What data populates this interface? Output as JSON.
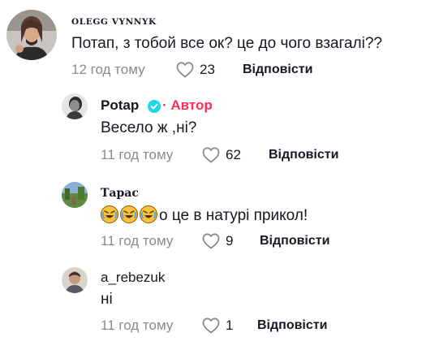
{
  "comments": [
    {
      "username": "OLEGG VYNNYK",
      "text": "Потап, з тобой все ок? це до чого взагалі??",
      "time": "12 год тому",
      "likes": "23",
      "reply_label": "Відповісти"
    },
    {
      "username": "Potap",
      "author_badge": "· Автор",
      "text": "Весело ж ,ні?",
      "time": "11 год тому",
      "likes": "62",
      "reply_label": "Відповісти"
    },
    {
      "username": "Тарас",
      "emoji": [
        "rolling-on-floor-laughing",
        "rolling-on-floor-laughing",
        "rolling-on-floor-laughing"
      ],
      "text": "о це в натурі прикол!",
      "time": "11 год тому",
      "likes": "9",
      "reply_label": "Відповісти"
    },
    {
      "username": "a_rebezuk",
      "text": "ні",
      "time": "11 год тому",
      "likes": "1",
      "reply_label": "Відповісти"
    }
  ],
  "colors": {
    "author_accent": "#fe2c55",
    "verified_blue": "#20d5ec",
    "meta_gray": "#8a8b91",
    "text_dark": "#161823"
  },
  "icons": {
    "like": "heart-outline-icon",
    "verified": "verified-check-icon"
  }
}
